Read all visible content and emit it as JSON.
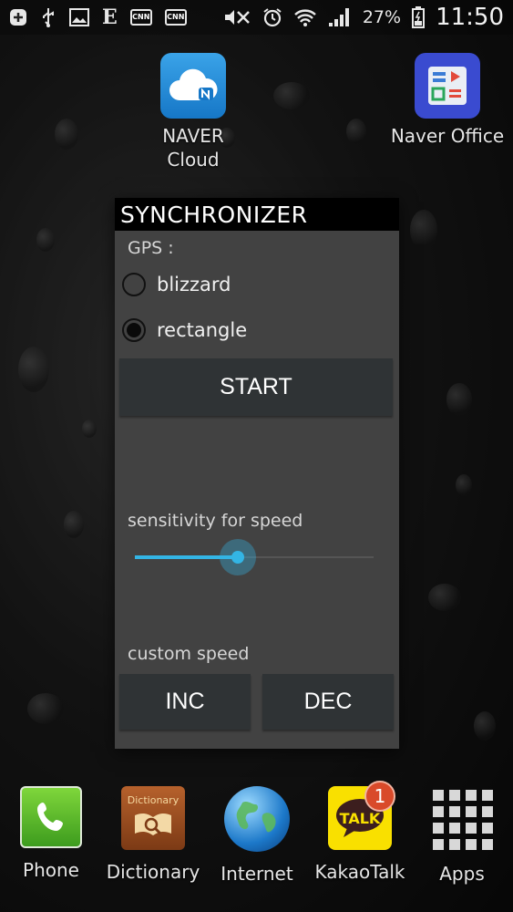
{
  "status_bar": {
    "battery_percent": "27%",
    "time": "11:50",
    "notification_icons": [
      "add-icon",
      "usb-icon",
      "gallery-icon",
      "e-icon",
      "cnn-icon",
      "cnn-icon"
    ],
    "cnn_label": "CNN",
    "e_label": "E"
  },
  "home_apps": [
    {
      "label_line1": "NAVER",
      "label_line2": "Cloud"
    },
    {
      "label_line1": "Naver Office",
      "label_line2": ""
    }
  ],
  "dialog": {
    "title": "SYNCHRONIZER",
    "gps_label": "GPS :",
    "options": [
      {
        "label": "blizzard",
        "selected": false
      },
      {
        "label": "rectangle",
        "selected": true
      }
    ],
    "start_label": "START",
    "sensitivity_label": "sensitivity for speed",
    "sensitivity_value": 0.43,
    "custom_speed_label": "custom speed",
    "inc_label": "INC",
    "dec_label": "DEC"
  },
  "dock": [
    {
      "label": "Phone"
    },
    {
      "label": "Dictionary",
      "icon_text": "Dictionary"
    },
    {
      "label": "Internet"
    },
    {
      "label": "KakaoTalk",
      "icon_text": "TALK",
      "badge": "1"
    },
    {
      "label": "Apps"
    }
  ],
  "colors": {
    "accent": "#33b5e5",
    "dialog_bg": "#424242",
    "button_bg": "#2f3335"
  }
}
